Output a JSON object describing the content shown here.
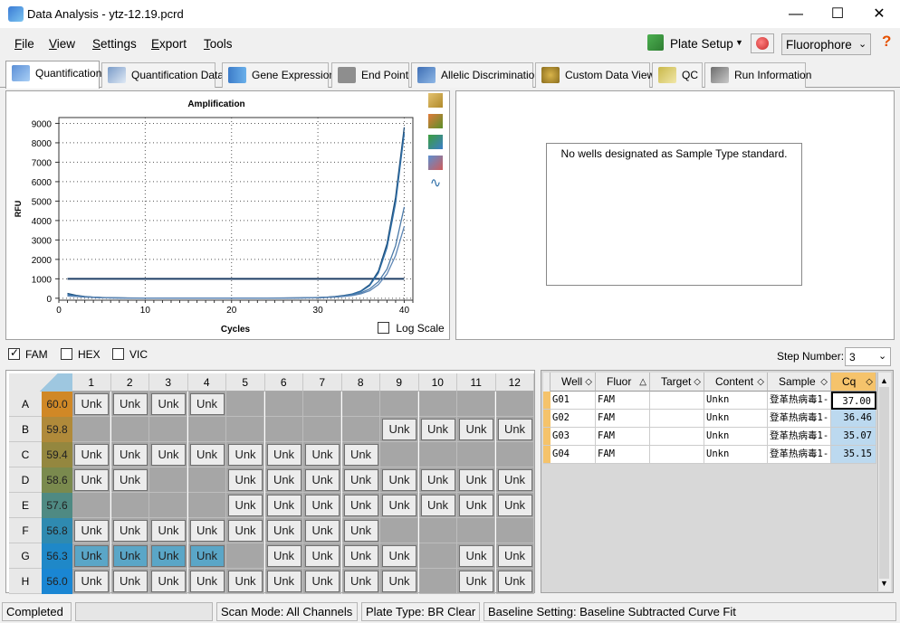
{
  "window": {
    "title": "Data Analysis - ytz-12.19.pcrd",
    "min": "—",
    "max": "☐",
    "close": "✕"
  },
  "menu": {
    "items": [
      "File",
      "View",
      "Settings",
      "Export",
      "Tools"
    ],
    "mnemonics": [
      "F",
      "V",
      "S",
      "E",
      "T"
    ],
    "plate_setup": "Plate Setup",
    "fluor_select": "Fluorophore",
    "help": "?"
  },
  "tabs": [
    "Quantification",
    "Quantification Data",
    "Gene Expression",
    "End Point",
    "Allelic Discrimination",
    "Custom Data View",
    "QC",
    "Run Information"
  ],
  "chart_data": {
    "type": "line",
    "title": "Amplification",
    "xlabel": "Cycles",
    "ylabel": "RFU",
    "xlim": [
      0,
      41
    ],
    "ylim": [
      -100,
      9300
    ],
    "xticks": [
      0,
      10,
      20,
      30,
      40
    ],
    "yticks": [
      0,
      1000,
      2000,
      3000,
      4000,
      5000,
      6000,
      7000,
      8000,
      9000
    ],
    "threshold": 1000,
    "x": [
      1,
      2,
      3,
      4,
      5,
      6,
      8,
      10,
      12,
      14,
      16,
      18,
      20,
      22,
      24,
      26,
      28,
      30,
      31,
      32,
      33,
      34,
      35,
      36,
      37,
      38,
      39,
      40
    ],
    "series": [
      {
        "values": [
          250,
          150,
          90,
          60,
          40,
          25,
          15,
          10,
          5,
          5,
          5,
          5,
          5,
          5,
          10,
          15,
          20,
          40,
          60,
          90,
          140,
          220,
          380,
          700,
          1400,
          2800,
          5200,
          8800
        ],
        "color": "#1f4e79"
      },
      {
        "values": [
          200,
          120,
          80,
          55,
          35,
          20,
          12,
          8,
          5,
          5,
          5,
          5,
          5,
          5,
          8,
          12,
          18,
          35,
          50,
          80,
          130,
          210,
          350,
          650,
          1300,
          2600,
          4900,
          8500
        ],
        "color": "#2f6fa8"
      },
      {
        "values": [
          150,
          100,
          70,
          50,
          30,
          18,
          10,
          6,
          4,
          4,
          4,
          4,
          4,
          4,
          6,
          10,
          15,
          30,
          45,
          70,
          110,
          170,
          280,
          480,
          850,
          1500,
          2700,
          4700
        ],
        "color": "#4a79a8"
      },
      {
        "values": [
          120,
          90,
          60,
          40,
          25,
          15,
          8,
          5,
          3,
          3,
          3,
          3,
          3,
          3,
          5,
          8,
          12,
          25,
          38,
          60,
          90,
          140,
          230,
          390,
          700,
          1250,
          2200,
          3700
        ],
        "color": "#5d86b5"
      }
    ]
  },
  "log_scale": "Log Scale",
  "no_std": "No wells designated as Sample Type standard.",
  "fluors": [
    "FAM",
    "HEX",
    "VIC"
  ],
  "fluors_checked": [
    true,
    false,
    false
  ],
  "step": {
    "label": "Step Number:",
    "value": "3"
  },
  "plate": {
    "cols": [
      "1",
      "2",
      "3",
      "4",
      "5",
      "6",
      "7",
      "8",
      "9",
      "10",
      "11",
      "12"
    ],
    "rows": [
      "A",
      "B",
      "C",
      "D",
      "E",
      "F",
      "G",
      "H"
    ],
    "temps": [
      "60.0",
      "59.8",
      "59.4",
      "58.6",
      "57.6",
      "56.8",
      "56.3",
      "56.0"
    ],
    "temp_colors": [
      "#d08826",
      "#b08a3a",
      "#94873f",
      "#7a8a4e",
      "#4f8a83",
      "#2f8ab0",
      "#1f88c8",
      "#1a86d3"
    ],
    "wells": [
      [
        "Unk",
        "Unk",
        "Unk",
        "Unk",
        "",
        "",
        "",
        "",
        "",
        "",
        "",
        ""
      ],
      [
        "",
        "",
        "",
        "",
        "",
        "",
        "",
        "",
        "Unk",
        "Unk",
        "Unk",
        "Unk"
      ],
      [
        "Unk",
        "Unk",
        "Unk",
        "Unk",
        "Unk",
        "Unk",
        "Unk",
        "Unk",
        "",
        "",
        "",
        ""
      ],
      [
        "Unk",
        "Unk",
        "",
        "",
        "Unk",
        "Unk",
        "Unk",
        "Unk",
        "Unk",
        "Unk",
        "Unk",
        "Unk"
      ],
      [
        "",
        "",
        "",
        "",
        "Unk",
        "Unk",
        "Unk",
        "Unk",
        "Unk",
        "Unk",
        "Unk",
        "Unk"
      ],
      [
        "Unk",
        "Unk",
        "Unk",
        "Unk",
        "Unk",
        "Unk",
        "Unk",
        "Unk",
        "",
        "",
        "",
        ""
      ],
      [
        "Unk",
        "Unk",
        "Unk",
        "Unk",
        "",
        "Unk",
        "Unk",
        "Unk",
        "Unk",
        "",
        "Unk",
        "Unk"
      ],
      [
        "Unk",
        "Unk",
        "Unk",
        "Unk",
        "Unk",
        "Unk",
        "Unk",
        "Unk",
        "Unk",
        "",
        "Unk",
        "Unk"
      ]
    ],
    "selected": [
      [
        6,
        0
      ],
      [
        6,
        1
      ],
      [
        6,
        2
      ],
      [
        6,
        3
      ]
    ]
  },
  "table": {
    "headers": [
      "Well",
      "Fluor",
      "Target",
      "Content",
      "Sample",
      "Cq"
    ],
    "rows": [
      [
        "G01",
        "FAM",
        "",
        "Unkn",
        "登革热病毒1-",
        "37.00"
      ],
      [
        "G02",
        "FAM",
        "",
        "Unkn",
        "登革热病毒1-",
        "36.46"
      ],
      [
        "G03",
        "FAM",
        "",
        "Unkn",
        "登革热病毒1-",
        "35.07"
      ],
      [
        "G04",
        "FAM",
        "",
        "Unkn",
        "登革热病毒1-",
        "35.15"
      ]
    ]
  },
  "status": {
    "completed": "Completed",
    "scan": "Scan Mode: All Channels",
    "plate_type": "Plate Type: BR Clear",
    "baseline": "Baseline Setting: Baseline Subtracted Curve Fit"
  },
  "colors": {
    "accent": "#f5a623",
    "selected_well": "#5aa6c7",
    "cq_cell": "#bcd9ef"
  }
}
